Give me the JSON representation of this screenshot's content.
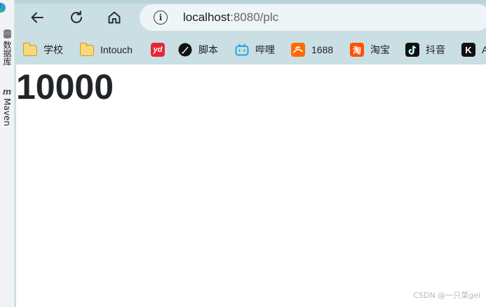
{
  "ide": {
    "db_tool_label": "数据库",
    "maven_tool_label": "Maven",
    "maven_glyph": "m"
  },
  "browser": {
    "nav": {
      "back_icon": "arrow-left-icon",
      "reload_icon": "reload-icon",
      "home_icon": "home-icon"
    },
    "address": {
      "info_glyph": "i",
      "host": "localhost",
      "rest": ":8080/plc"
    },
    "bookmarks": [
      {
        "label": "学校",
        "icon": "folder-icon"
      },
      {
        "label": "Intouch",
        "icon": "folder-icon"
      },
      {
        "label": "",
        "icon": "yd-icon",
        "glyph": "yd",
        "color": "#e8263b"
      },
      {
        "label": "脚本",
        "icon": "quill-icon"
      },
      {
        "label": "哔哩",
        "icon": "bilibili-icon",
        "color": "#22a7e0"
      },
      {
        "label": "1688",
        "icon": "1688-icon",
        "color": "#ff6a00"
      },
      {
        "label": "淘宝",
        "icon": "taobao-icon",
        "glyph": "淘",
        "color": "#ff5000"
      },
      {
        "label": "抖音",
        "icon": "douyin-icon"
      },
      {
        "label": "A",
        "icon": "k-icon",
        "glyph": "K"
      }
    ]
  },
  "page": {
    "value": "10000",
    "watermark": "CSDN @一只菜gei"
  }
}
